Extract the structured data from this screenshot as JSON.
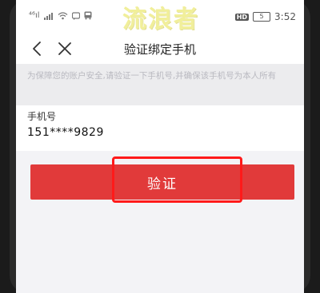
{
  "status_bar": {
    "left_text": "⁴⁶ıl",
    "hd_badge": "HD",
    "battery_level": "5",
    "time": "3:52"
  },
  "watermark": "流浪者",
  "nav": {
    "title": "验证绑定手机"
  },
  "notice": {
    "text": "为保障您的账户安全,请验证一下手机号,并确保该手机号为本人所有"
  },
  "phone_field": {
    "label": "手机号",
    "value": "151****9829"
  },
  "verify_button": {
    "label": "验证"
  },
  "colors": {
    "accent": "#e13a3a",
    "highlight": "#ff1a1a"
  }
}
